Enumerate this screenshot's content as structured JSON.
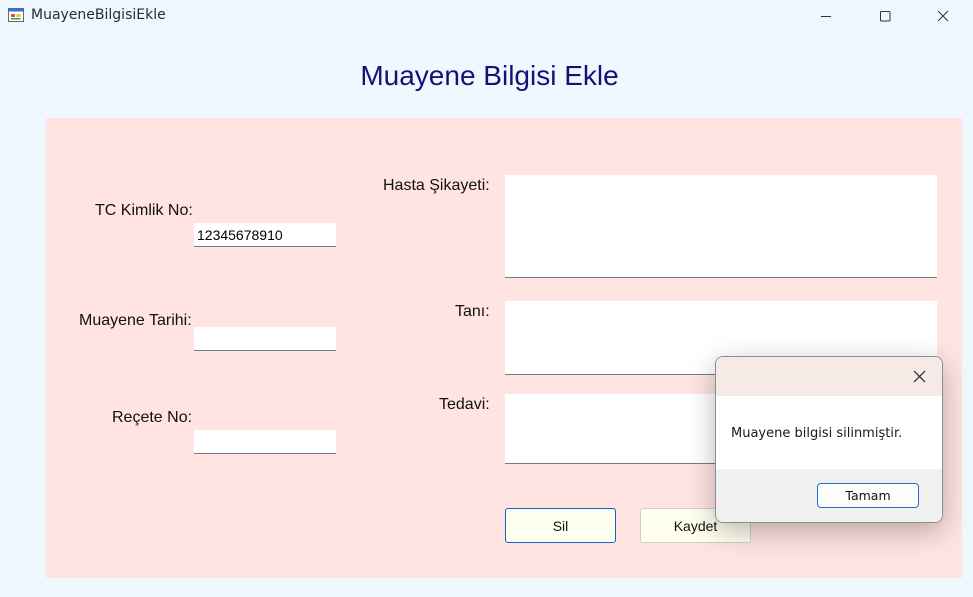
{
  "window": {
    "title": "MuayeneBilgisiEkle",
    "icon": "form-app-icon",
    "controls": [
      "minimize-icon",
      "maximize-icon",
      "close-icon"
    ]
  },
  "form": {
    "heading": "Muayene Bilgisi Ekle",
    "heading_color": "#131376",
    "panel_color": "#ffe4e1",
    "tc_label": "TC Kimlik No:",
    "tc_value": "12345678910",
    "date_label": "Muayene Tarihi:",
    "date_value": "",
    "prescription_label": "Reçete No:",
    "prescription_value": "",
    "complaint_label": "Hasta Şikayeti:",
    "complaint_value": "",
    "diagnosis_label": "Tanı:",
    "diagnosis_value": "",
    "treatment_label": "Tedavi:",
    "treatment_value": "",
    "delete_button": "Sil",
    "save_button": "Kaydet"
  },
  "messagebox": {
    "message": "Muayene bilgisi silinmiştir.",
    "ok_button": "Tamam",
    "close_icon": "close-icon"
  }
}
